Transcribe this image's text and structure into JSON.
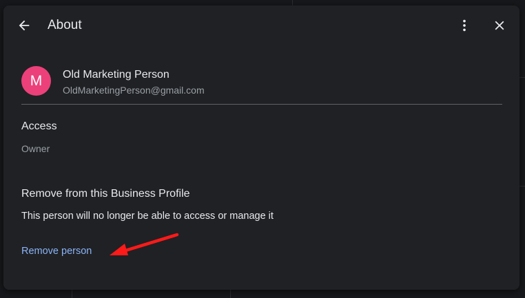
{
  "header": {
    "title": "About"
  },
  "user": {
    "avatar_letter": "M",
    "avatar_color": "#ec407a",
    "name": "Old Marketing Person",
    "email": "OldMarketingPerson@gmail.com"
  },
  "access": {
    "heading": "Access",
    "role": "Owner"
  },
  "remove_section": {
    "heading": "Remove from this Business Profile",
    "description": "This person will no longer be able to access or manage it",
    "link_label": "Remove person",
    "link_color": "#8ab4f8"
  },
  "icons": {
    "back": "arrow-back-icon",
    "more": "more-vert-icon",
    "close": "close-icon",
    "annotation": "red-arrow-icon"
  },
  "colors": {
    "dialog_bg": "#202124",
    "annotation_arrow": "#ff1a1a"
  }
}
